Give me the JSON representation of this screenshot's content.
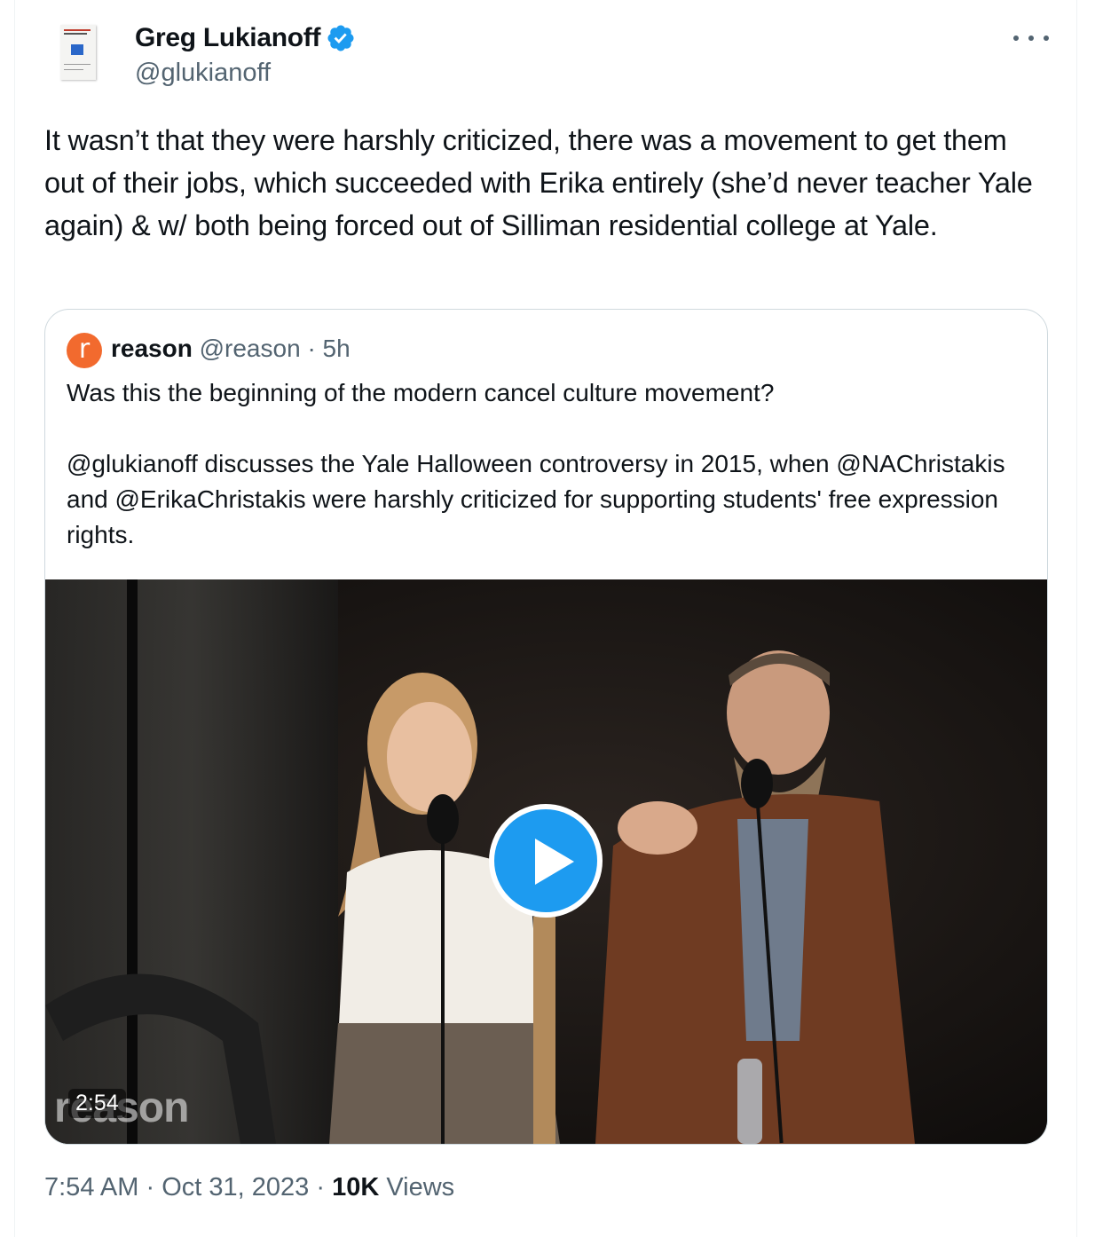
{
  "author": {
    "name": "Greg Lukianoff",
    "handle": "@glukianoff",
    "verified": true,
    "avatar_icon": "book-cover-avatar"
  },
  "more_icon": "more-options-icon",
  "tweet": {
    "text": "It wasn’t that they were harshly criticized, there was a movement to get them out of their jobs, which succeeded with Erika entirely (she’d never teacher Yale again) & w/ both being forced out of Silliman residential college at Yale."
  },
  "quoted": {
    "avatar_letter": "r",
    "name": "reason",
    "handle": "@reason",
    "separator": "·",
    "time": "5h",
    "text": "Was this the beginning of the modern cancel culture movement?\n\n@glukianoff discusses the Yale Halloween controversy in 2015, when @NAChristakis and @ErikaChristakis were harshly criticized for supporting students' free expression rights.",
    "video": {
      "duration": "2:54",
      "watermark": "reason",
      "play_icon": "play-icon"
    }
  },
  "footer": {
    "time": "7:54 AM",
    "sep1": "·",
    "date": "Oct 31, 2023",
    "sep2": "·",
    "views_count": "10K",
    "views_label": "Views"
  },
  "colors": {
    "accent": "#1d9bf0",
    "secondary_text": "#536471",
    "border": "#cfd9de",
    "reason_orange": "#f26a2e"
  }
}
